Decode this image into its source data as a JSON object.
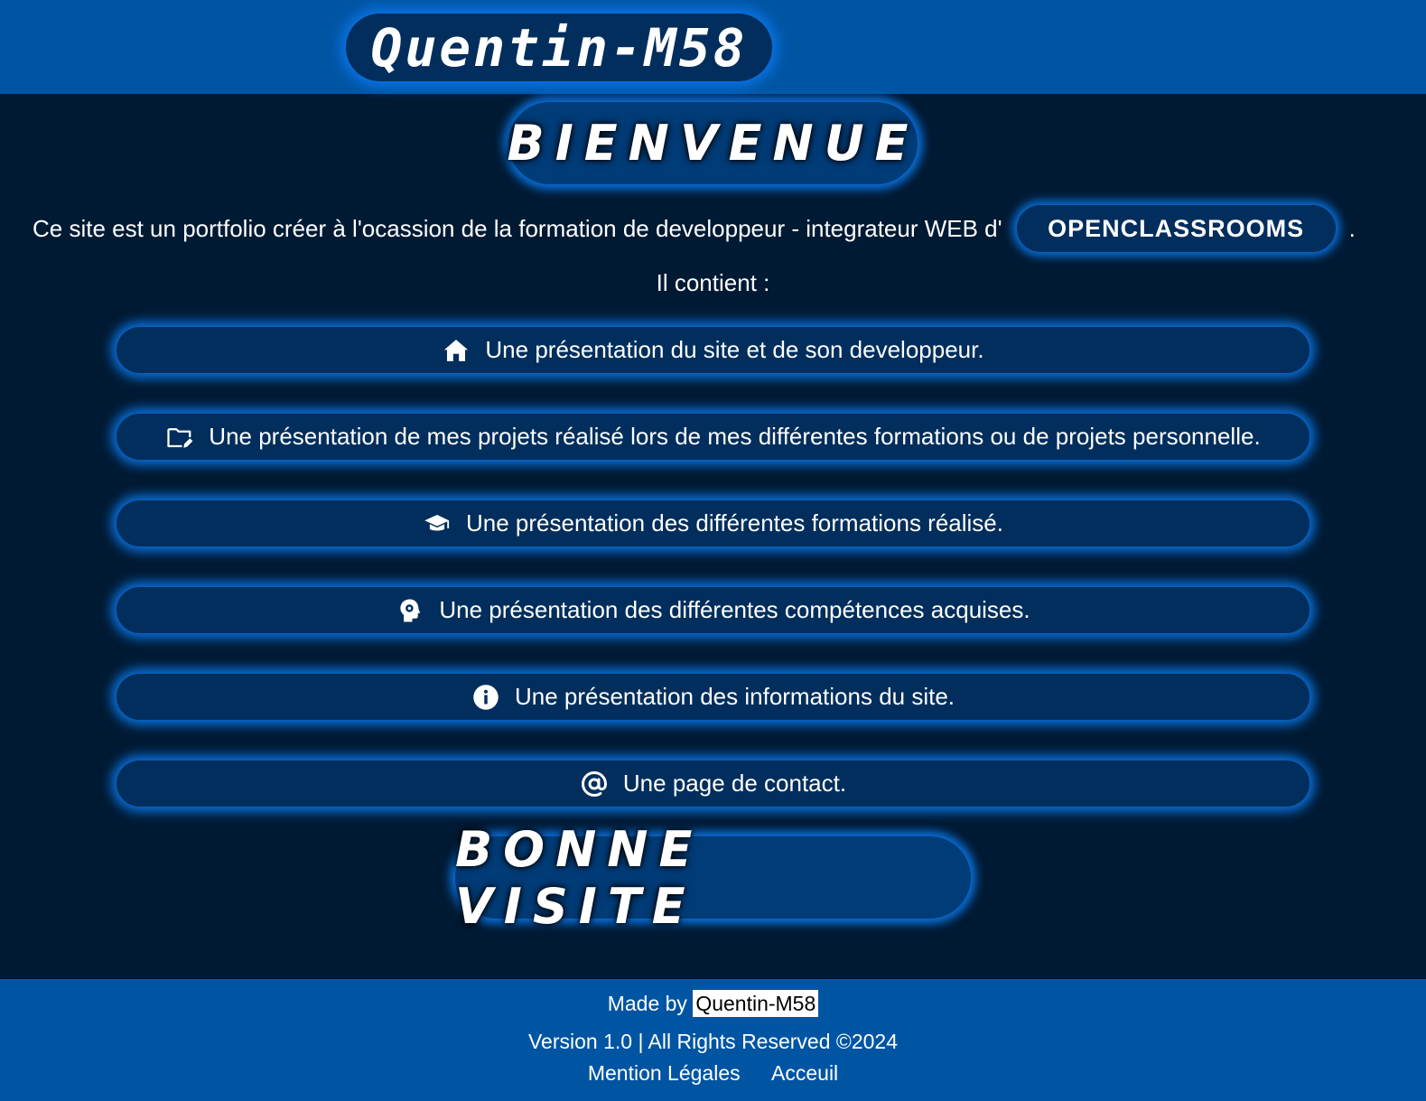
{
  "header": {
    "brand": "Quentin-M58"
  },
  "main": {
    "welcome_title": "BIENVENUE",
    "intro_text": "Ce site est un portfolio créer à l'ocassion de la formation de developpeur - integrateur WEB d'",
    "intro_badge": "OPENCLASSROOMS",
    "intro_period": ".",
    "contains_label": "Il contient :",
    "sections": [
      {
        "icon": "home-icon",
        "label": "Une présentation du site et de son developpeur."
      },
      {
        "icon": "folder-edit-icon",
        "label": "Une présentation de mes projets réalisé lors de mes différentes formations ou de projets personnelle."
      },
      {
        "icon": "graduation-cap-icon",
        "label": "Une présentation des différentes formations réalisé."
      },
      {
        "icon": "head-gear-icon",
        "label": "Une présentation des différentes compétences acquises."
      },
      {
        "icon": "info-icon",
        "label": "Une présentation des informations du site."
      },
      {
        "icon": "at-sign-icon",
        "label": "Une page de contact."
      }
    ],
    "goodbye_title": "BONNE VISITE"
  },
  "footer": {
    "made_by_label": "Made by",
    "author": "Quentin-M58",
    "version": "Version 1.0 | All Rights Reserved ©2024",
    "links": [
      "Mention Légales",
      "Acceuil"
    ]
  },
  "colors": {
    "header_bg": "#0055a3",
    "page_bg": "#011a33",
    "pill_bg": "#012e5c",
    "glow": "#0a6fd8"
  }
}
